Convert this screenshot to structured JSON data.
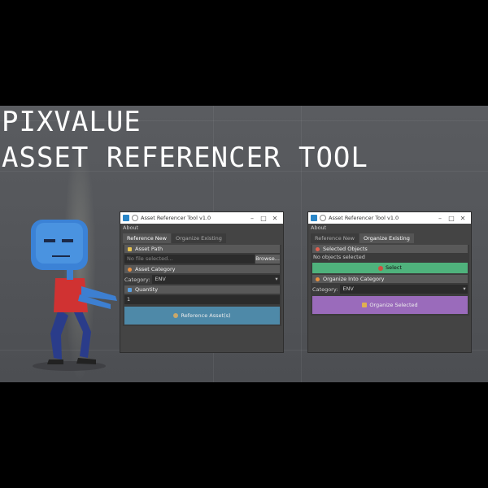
{
  "headline": {
    "line1": "PIXVALUE",
    "line2": "ASSET REFERENCER TOOL"
  },
  "left_window": {
    "title": "Asset Referencer Tool v1.0",
    "menu": "About",
    "tabs": [
      "Reference New",
      "Organize Existing"
    ],
    "asset_path": {
      "header": "Asset Path",
      "placeholder": "No file selected...",
      "browse": "Browse..."
    },
    "asset_category": {
      "header": "Asset Category",
      "label": "Category:",
      "value": "ENV"
    },
    "quantity": {
      "header": "Quantity",
      "value": "1"
    },
    "action_button": "Reference Asset(s)"
  },
  "right_window": {
    "title": "Asset Referencer Tool v1.0",
    "menu": "About",
    "tabs": [
      "Reference New",
      "Organize Existing"
    ],
    "selected_objects": {
      "header": "Selected Objects",
      "status": "No objects selected",
      "select_button": "Select"
    },
    "organize": {
      "header": "Organize Into Category",
      "label": "Category:",
      "value": "ENV",
      "button": "Organize Selected"
    }
  },
  "colors": {
    "reference_button": "#4e89a8",
    "select_button": "#4fb27c",
    "organize_button": "#9a6bbb",
    "title_icon": "#2a86c8"
  },
  "icons": {
    "folder": "folder-icon",
    "category": "tag-icon",
    "quantity": "hash-icon",
    "selected": "target-icon",
    "organize": "sort-icon"
  }
}
